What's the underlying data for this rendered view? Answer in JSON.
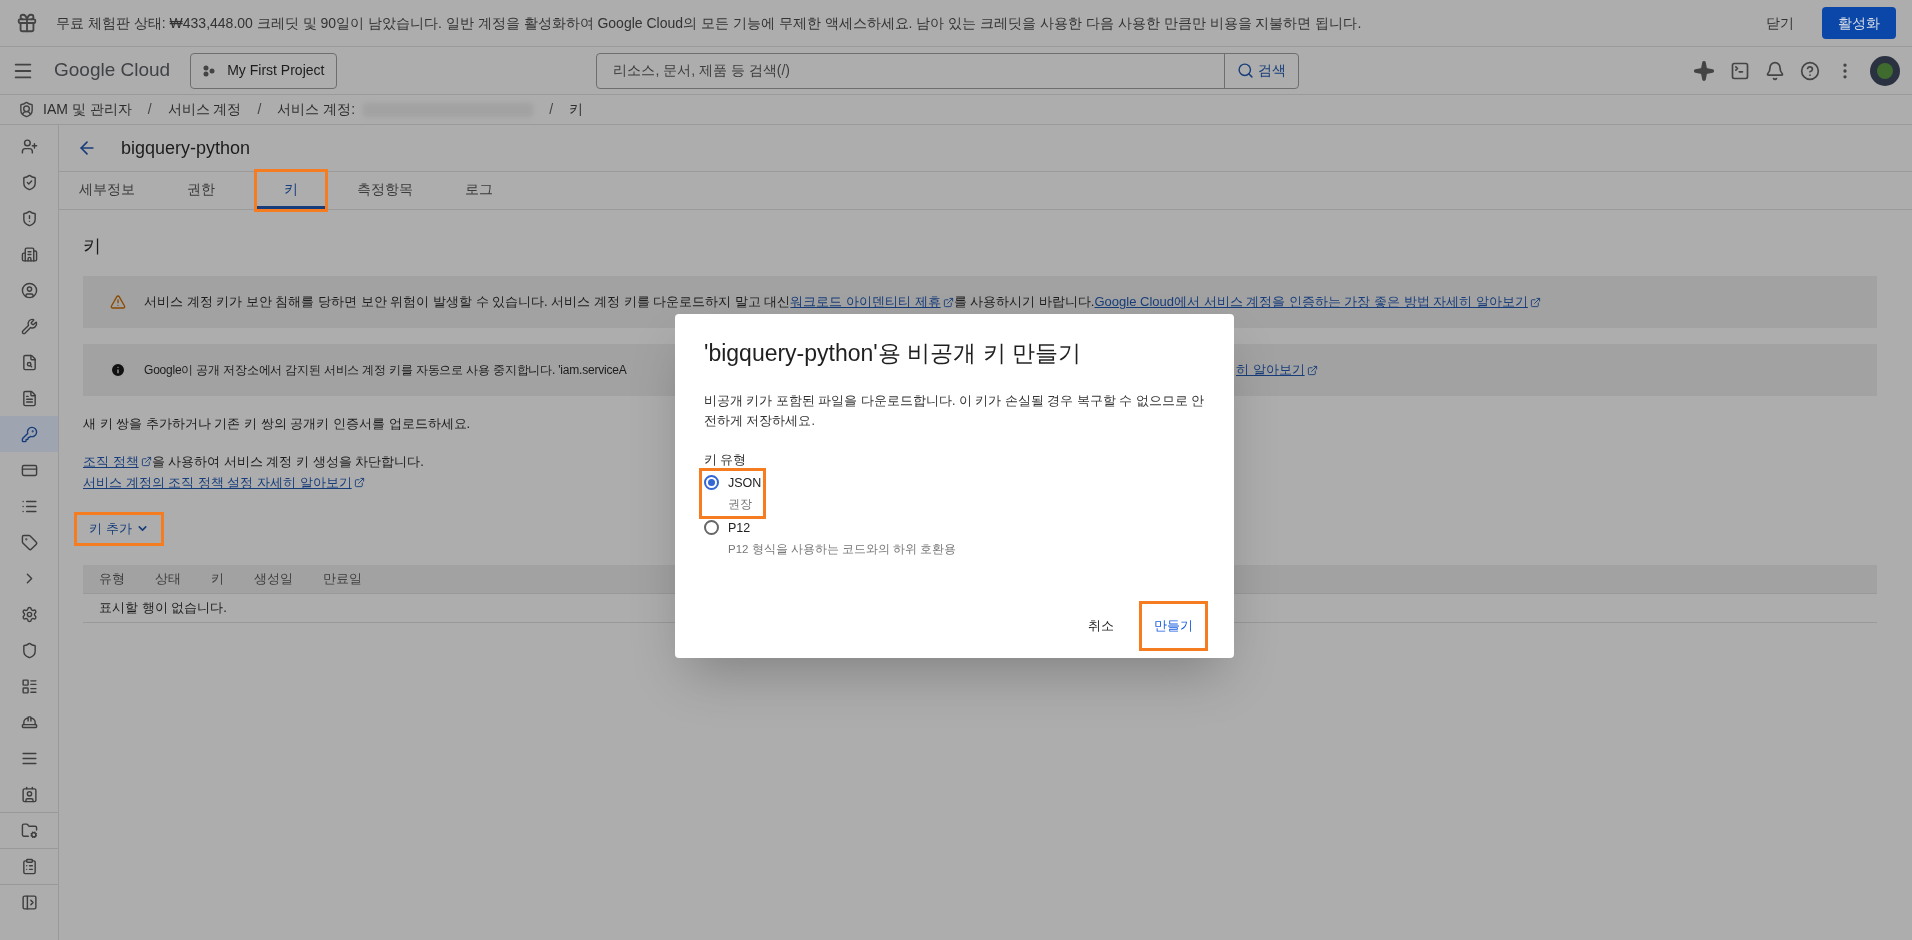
{
  "promo_bar": {
    "message": "무료 체험판 상태: ₩433,448.00 크레딧 및 90일이 남았습니다. 일반 계정을 활성화하여 Google Cloud의 모든 기능에 무제한 액세스하세요. 남아 있는 크레딧을 사용한 다음 사용한 만큼만 비용을 지불하면 됩니다.",
    "close": "닫기",
    "activate": "활성화"
  },
  "header": {
    "logo": "Google Cloud",
    "project": "My First Project",
    "search": {
      "placeholder": "리소스, 문서, 제품 등 검색(/)",
      "button": "검색"
    }
  },
  "breadcrumb": {
    "items": [
      {
        "kind": "link",
        "label": "IAM 및 관리자"
      },
      {
        "kind": "link",
        "separator": "/",
        "label": "서비스 계정"
      },
      {
        "kind": "link",
        "separator": "/",
        "label": "서비스 계정:"
      },
      {
        "kind": "blurred"
      },
      {
        "kind": "link",
        "separator": "/",
        "label": "키"
      }
    ]
  },
  "sidebar": {
    "items": [
      {
        "selected": false
      },
      {
        "selected": false
      },
      {
        "selected": false
      },
      {
        "selected": false
      },
      {
        "selected": false
      },
      {
        "selected": false
      },
      {
        "selected": false
      },
      {
        "selected": false
      },
      {
        "selected": true
      },
      {
        "selected": false
      },
      {
        "selected": false
      },
      {
        "selected": false
      },
      {
        "selected": false
      },
      {
        "selected": false
      },
      {
        "selected": false
      },
      {
        "selected": false
      },
      {
        "selected": false
      },
      {
        "selected": false
      },
      {
        "selected": false
      }
    ]
  },
  "page": {
    "title": "bigquery-python",
    "tabs": [
      {
        "label": "세부정보",
        "selected": false,
        "highlighted": false
      },
      {
        "label": "권한",
        "selected": false,
        "highlighted": false
      },
      {
        "label": "키",
        "selected": true,
        "highlighted": true
      },
      {
        "label": "측정항목",
        "selected": false,
        "highlighted": false
      },
      {
        "label": "로그",
        "selected": false,
        "highlighted": false
      }
    ],
    "section_title": "키",
    "alerts": [
      {
        "kind": "warning",
        "segments": [
          {
            "kind": "text",
            "text": "서비스 계정 키가 보안 침해를 당하면 보안 위험이 발생할 수 있습니다. 서비스 계정 키를 다운로드하지 말고 대신 "
          },
          {
            "kind": "link",
            "text": "워크로드 아이덴티티 제휴"
          },
          {
            "kind": "text",
            "text": "를 사용하시기 바랍니다. "
          },
          {
            "kind": "link",
            "text": "Google Cloud에서 서비스 계정을 인증하는 가장 좋은 방법 자세히 알아보기"
          }
        ]
      },
      {
        "kind": "info",
        "segments": [
          {
            "kind": "text",
            "text": "Google이 공개 저장소에서 감지된 서비스 계정 키를 자동으로 사용 중지합니다. 'iam.serviceA"
          }
        ],
        "trailing": [
          {
            "kind": "link",
            "text": "히 알아보기"
          }
        ]
      }
    ],
    "description": "새 키 쌍을 추가하거나 기존 키 쌍의 공개키 인증서를 업로드하세요.",
    "policy_lines": [
      [
        {
          "kind": "link",
          "text": "조직 정책"
        },
        {
          "kind": "text",
          "text": "을 사용하여 서비스 계정 키 생성을 차단합니다."
        }
      ],
      [
        {
          "kind": "link",
          "text": "서비스 계정의 조직 정책 설정 자세히 알아보기"
        }
      ]
    ],
    "add_key": {
      "label": "키 추가",
      "highlighted": true
    },
    "table": {
      "columns": [
        "유형",
        "상태",
        "키",
        "생성일",
        "만료일"
      ],
      "empty": "표시할 행이 없습니다."
    }
  },
  "dialog": {
    "title": "'bigquery-python'용 비공개 키 만들기",
    "body": "비공개 키가 포함된 파일을 다운로드합니다. 이 키가 손실될 경우 복구할 수 없으므로 안전하게 저장하세요.",
    "key_type_label": "키 유형",
    "options": [
      {
        "label": "JSON",
        "hint": "권장",
        "selected": true,
        "highlighted": true
      },
      {
        "label": "P12",
        "hint": "P12 형식을 사용하는 코드와의 하위 호환용",
        "selected": false,
        "highlighted": false
      }
    ],
    "buttons": [
      {
        "label": "취소",
        "kind": "text",
        "highlighted": false
      },
      {
        "label": "만들기",
        "kind": "primary",
        "highlighted": true
      }
    ]
  }
}
